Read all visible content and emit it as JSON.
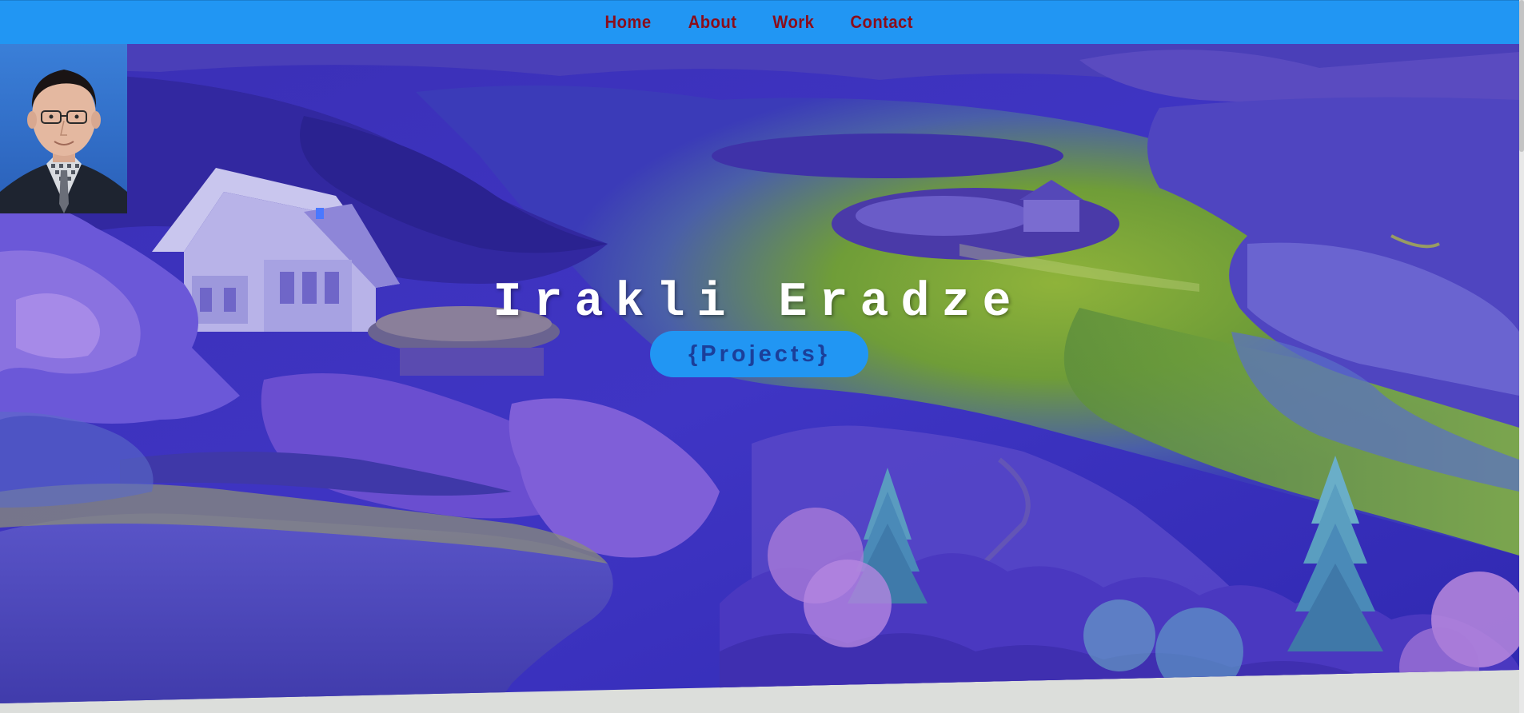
{
  "nav": {
    "items": [
      {
        "label": "Home"
      },
      {
        "label": "About"
      },
      {
        "label": "Work"
      },
      {
        "label": "Contact"
      }
    ]
  },
  "hero": {
    "title": "Irakli Eradze",
    "button_label": "{Projects}"
  },
  "colors": {
    "nav_background": "#2196f3",
    "nav_link": "#8b0d1a",
    "button_background": "#2196f3",
    "button_text": "#1b3f9a",
    "title_text": "#ffffff",
    "page_background": "#dcdedb"
  }
}
